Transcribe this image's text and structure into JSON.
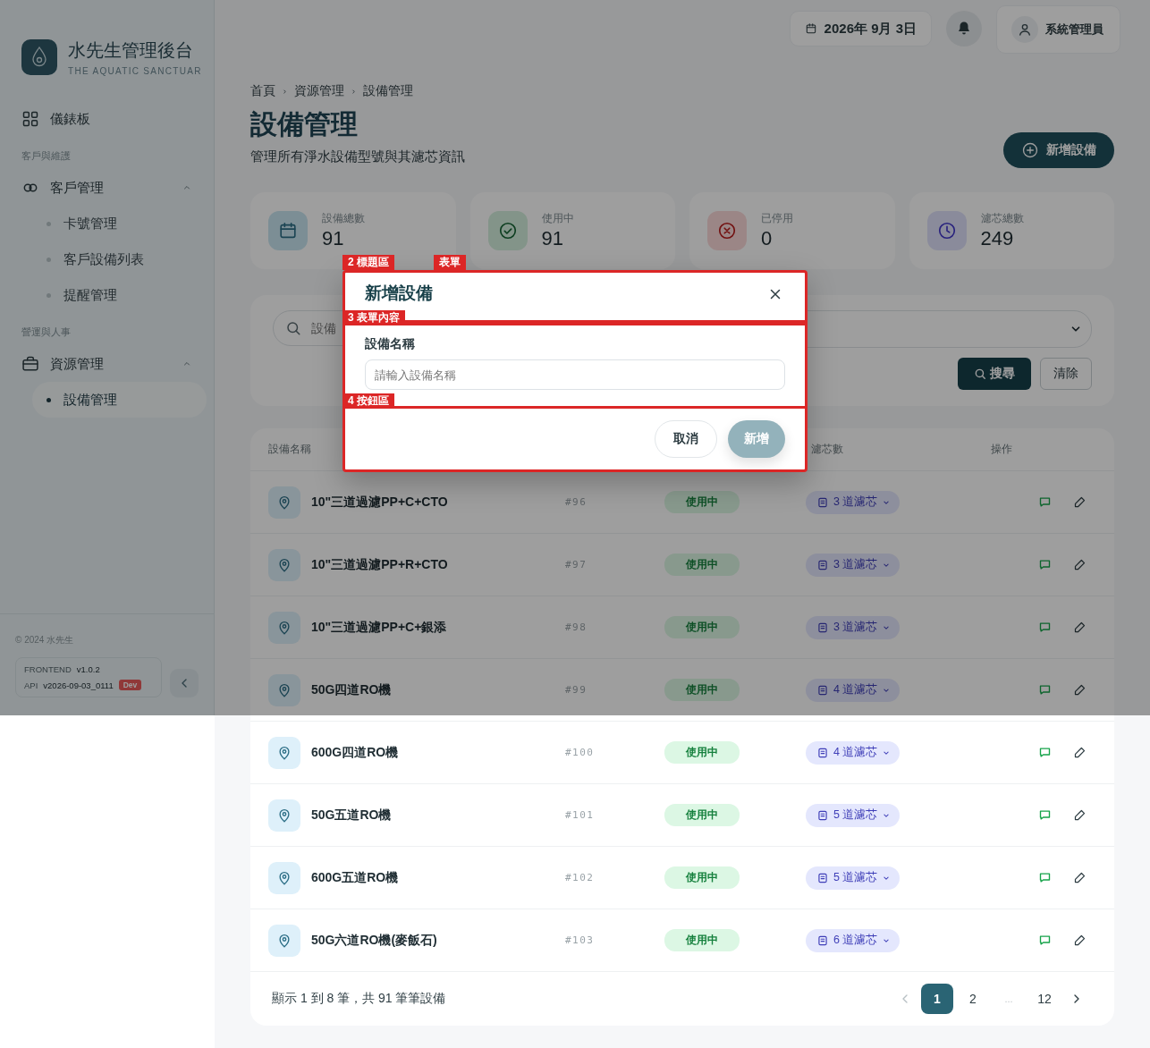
{
  "sidebar": {
    "brand": {
      "title": "水先生管理後台",
      "subtitle": "THE AQUATIC SANCTUAR"
    },
    "nav": [
      {
        "kind": "link",
        "label": "儀錶板"
      },
      {
        "kind": "section",
        "label": "客戶與維護"
      },
      {
        "kind": "group",
        "label": "客戶管理",
        "expanded": true,
        "children": [
          {
            "label": "卡號管理",
            "selected": false
          },
          {
            "label": "客戶設備列表",
            "selected": false
          },
          {
            "label": "提醒管理",
            "selected": false
          }
        ]
      },
      {
        "kind": "section",
        "label": "營運與人事"
      },
      {
        "kind": "group",
        "label": "資源管理",
        "expanded": true,
        "children": [
          {
            "label": "設備管理",
            "selected": true
          }
        ]
      }
    ],
    "footer": {
      "copyright": "© 2024 水先生",
      "frontend_label": "FRONTEND",
      "frontend_version": "v1.0.2",
      "api_label": "API",
      "api_version": "v2026-09-03_0111",
      "env_badge": "Dev"
    }
  },
  "topbar": {
    "date": "2026年 9月 3日",
    "user": "系統管理員"
  },
  "breadcrumb": [
    "首頁",
    "資源管理",
    "設備管理"
  ],
  "page": {
    "title": "設備管理",
    "subtitle": "管理所有淨水設備型號與其濾芯資訊",
    "add_button": "新增設備"
  },
  "stats": [
    {
      "kind": "calendar",
      "label": "設備總數",
      "value": "91"
    },
    {
      "kind": "check",
      "label": "使用中",
      "value": "91"
    },
    {
      "kind": "cross",
      "label": "已停用",
      "value": "0"
    },
    {
      "kind": "clock",
      "label": "濾芯總數",
      "value": "249"
    }
  ],
  "filters": {
    "search_placeholder": "設備",
    "search_button": "搜尋",
    "clear_button": "清除"
  },
  "table": {
    "columns": {
      "name": "設備名稱",
      "filters": "濾芯數",
      "actions": "操作"
    },
    "rows": [
      {
        "name": "10\"三道過濾PP+C+CTO",
        "code": "#96",
        "status": "使用中",
        "filters": "3 道濾芯"
      },
      {
        "name": "10\"三道過濾PP+R+CTO",
        "code": "#97",
        "status": "使用中",
        "filters": "3 道濾芯"
      },
      {
        "name": "10\"三道過濾PP+C+銀添",
        "code": "#98",
        "status": "使用中",
        "filters": "3 道濾芯"
      },
      {
        "name": "50G四道RO機",
        "code": "#99",
        "status": "使用中",
        "filters": "4 道濾芯"
      },
      {
        "name": "600G四道RO機",
        "code": "#100",
        "status": "使用中",
        "filters": "4 道濾芯"
      },
      {
        "name": "50G五道RO機",
        "code": "#101",
        "status": "使用中",
        "filters": "5 道濾芯"
      },
      {
        "name": "600G五道RO機",
        "code": "#102",
        "status": "使用中",
        "filters": "5 道濾芯"
      },
      {
        "name": "50G六道RO機(麥飯石)",
        "code": "#103",
        "status": "使用中",
        "filters": "6 道濾芯"
      }
    ],
    "summary": "顯示 1 到 8 筆，共 91 筆筆設備",
    "pagination": {
      "prev_disabled": true,
      "next_disabled": false,
      "pages": [
        {
          "kind": "page",
          "label": "1",
          "selected": true
        },
        {
          "kind": "page",
          "label": "2",
          "selected": false
        },
        {
          "kind": "ellipsis",
          "label": "..."
        },
        {
          "kind": "page",
          "label": "12",
          "selected": false
        }
      ]
    }
  },
  "modal": {
    "title": "新增設備",
    "field_label": "設備名稱",
    "placeholder": "請輸入設備名稱",
    "cancel": "取消",
    "submit": {
      "label": "新增",
      "disabled": true
    },
    "annotations": {
      "form": "表單",
      "header": "2 標題區",
      "body": "3 表單內容",
      "footer": "4 按鈕區"
    }
  }
}
